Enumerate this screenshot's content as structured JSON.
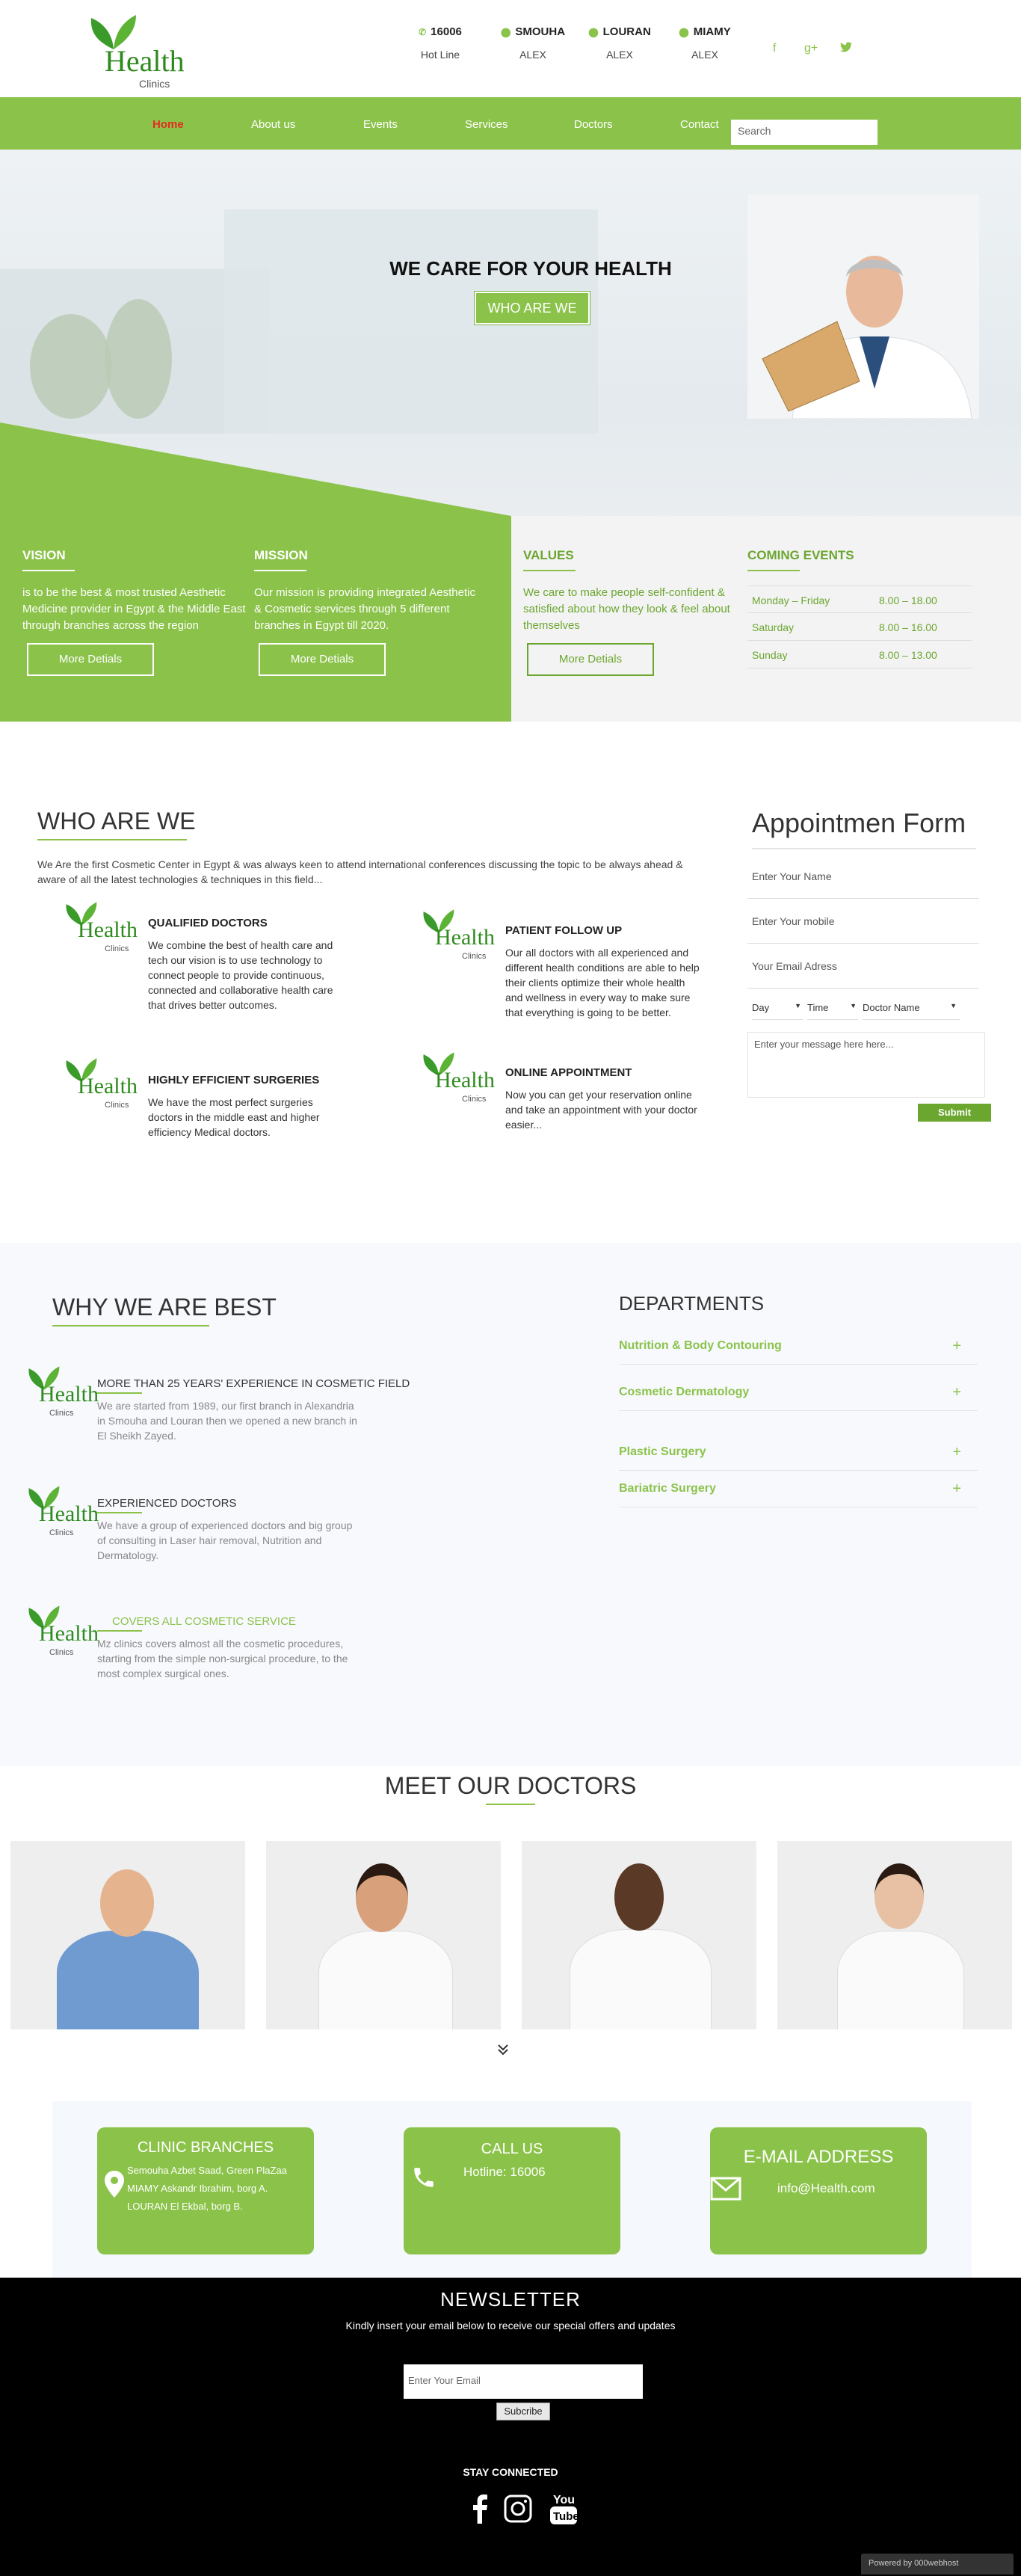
{
  "header": {
    "logo_word": "Health",
    "logo_sub": "Clinics",
    "contacts": [
      {
        "top": "16006",
        "bottom": "Hot Line",
        "icon": "phone-icon"
      },
      {
        "top": "SMOUHA",
        "bottom": "ALEX",
        "icon": "map-pin-icon"
      },
      {
        "top": "LOURAN",
        "bottom": "ALEX",
        "icon": "map-pin-icon"
      },
      {
        "top": "MIAMY",
        "bottom": "ALEX",
        "icon": "map-pin-icon"
      }
    ],
    "social": [
      "f",
      "g+",
      "twitter-icon"
    ]
  },
  "nav": {
    "items": [
      "Home",
      "About us",
      "Events",
      "Services",
      "Doctors",
      "Contact"
    ],
    "active": "Home",
    "search_placeholder": "Search"
  },
  "hero": {
    "heading": "WE CARE FOR YOUR HEALTH",
    "button": "WHO ARE WE"
  },
  "panels": {
    "vision": {
      "title": "VISION",
      "text": "is to be the best & most trusted Aesthetic Medicine provider in Egypt & the Middle East through branches across the region",
      "button": "More Detials"
    },
    "mission": {
      "title": "MISSION",
      "text": "Our mission is providing integrated Aesthetic & Cosmetic services through 5 different branches in Egypt till 2020.",
      "button": "More Detials"
    },
    "values": {
      "title": "VALUES",
      "text": "We care to make people self-confident & satisfied about how they look & feel about themselves",
      "button": "More Detials"
    },
    "events": {
      "title": "COMING EVENTS",
      "rows": [
        {
          "day": "Monday – Friday",
          "time": "8.00 – 18.00"
        },
        {
          "day": "Saturday",
          "time": "8.00 – 16.00"
        },
        {
          "day": "Sunday",
          "time": "8.00 – 13.00"
        }
      ]
    }
  },
  "who": {
    "title": "WHO ARE WE",
    "intro": "We Are the first Cosmetic Center in Egypt & was always keen to attend international conferences discussing the topic to be always ahead & aware of all the latest technologies & techniques in this field...",
    "features": [
      {
        "title": "QUALIFIED DOCTORS",
        "text": "We combine the best of health care and tech our vision is to use technology to connect people to provide continuous, connected and collaborative health care that drives better outcomes."
      },
      {
        "title": "PATIENT FOLLOW UP",
        "text": "Our all doctors with all experienced and different health conditions are able to help their clients optimize their whole health and wellness in every way to make sure that everything is going to be better."
      },
      {
        "title": "HIGHLY EFFICIENT SURGERIES",
        "text": "We have the most perfect surgeries doctors in the middle east and higher efficiency Medical doctors."
      },
      {
        "title": "ONLINE APPOINTMENT",
        "text": "Now you can get your reservation online and take an appointment with your doctor easier..."
      }
    ]
  },
  "appointment": {
    "title": "Appointmen Form",
    "name_placeholder": "Enter Your Name",
    "mobile_placeholder": "Enter Your mobile",
    "email_placeholder": "Your Email Adress",
    "day": "Day",
    "time": "Time",
    "doctor": "Doctor Name",
    "message_placeholder": "Enter your message here here...",
    "submit": "Submit"
  },
  "why": {
    "title": "WHY WE ARE BEST",
    "items": [
      {
        "title": "MORE THAN 25 YEARS' EXPERIENCE IN COSMETIC FIELD",
        "text": "We are started from 1989, our first branch in Alexandria in Smouha and Louran then we opened a new branch in El Sheikh Zayed."
      },
      {
        "title": "EXPERIENCED DOCTORS",
        "text": "We have a group of experienced doctors and big group of consulting in Laser hair removal, Nutrition and Dermatology."
      },
      {
        "title": "COVERS ALL COSMETIC SERVICE",
        "text": "Mz clinics covers almost all the cosmetic procedures, starting from the simple non-surgical procedure, to the most complex surgical ones."
      }
    ]
  },
  "departments": {
    "title": "DEPARTMENTS",
    "items": [
      "Nutrition & Body Contouring",
      "Cosmetic Dermatology",
      "Plastic Surgery",
      "Bariatric Surgery"
    ]
  },
  "doctors": {
    "title": "MEET OUR DOCTORS"
  },
  "info": {
    "branches": {
      "title": "CLINIC BRANCHES",
      "lines": [
        "Semouha Azbet Saad, Green PlaZaa",
        "MIAMY Askandr Ibrahim, borg A.",
        "LOURAN El Ekbal, borg B."
      ]
    },
    "call": {
      "title": "CALL US",
      "line": "Hotline: 16006"
    },
    "email": {
      "title": "E-MAIL ADDRESS",
      "line": "info@Health.com"
    }
  },
  "footer": {
    "newsletter_title": "NEWSLETTER",
    "newsletter_sub": "Kindly insert your email below to receive our special offers and updates",
    "email_placeholder": "Enter Your Email",
    "subscribe": "Subcribe",
    "stay": "STAY CONNECTED",
    "badge": "Powered by  000webhost"
  },
  "colors": {
    "accent": "#8bc34a",
    "dark_green": "#2e8b1e"
  }
}
